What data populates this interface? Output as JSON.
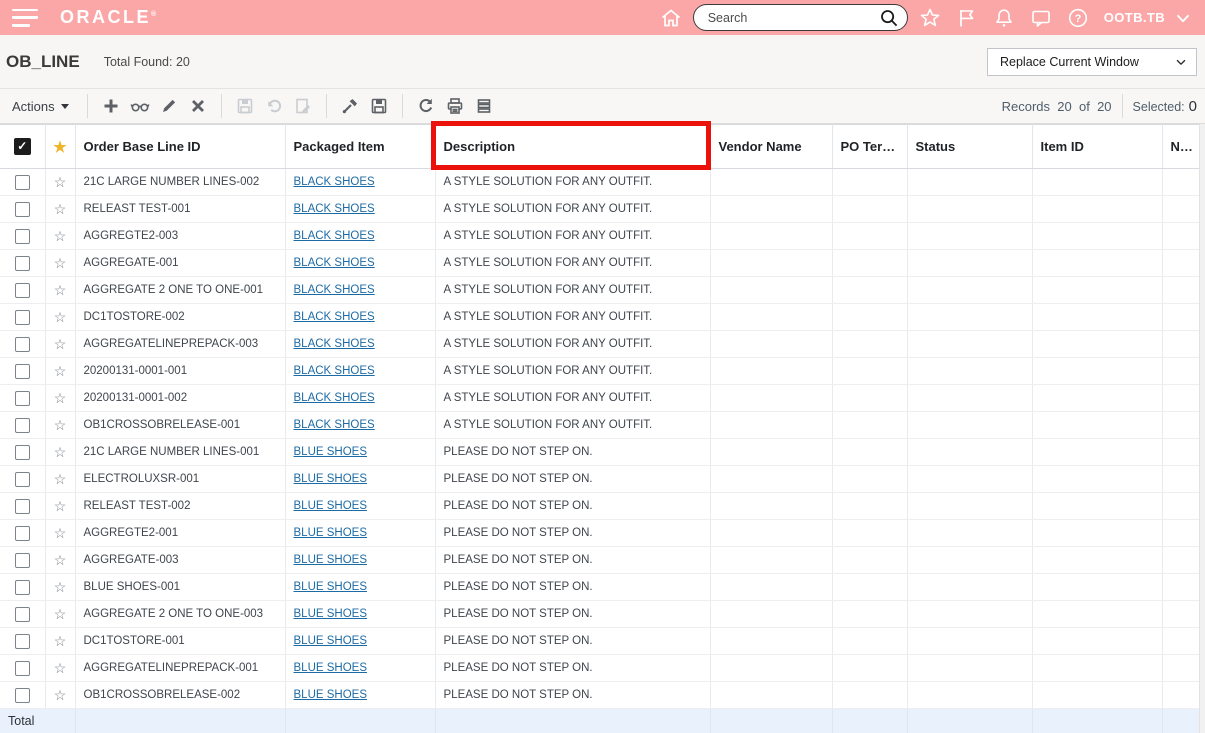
{
  "colors": {
    "header_bg": "#fba7a7",
    "link": "#1d6ba5",
    "annotation_red": "#ea120b",
    "total_row_bg": "#e9f2fc",
    "star_gold": "#f0b429"
  },
  "header": {
    "brand": "ORACLE",
    "search_placeholder": "Search",
    "username": "OOTB.TB",
    "icons": [
      "menu-icon",
      "home-icon",
      "search-icon",
      "favorites-icon",
      "flag-icon",
      "notifications-icon",
      "messages-icon",
      "help-icon",
      "chevron-down-icon"
    ]
  },
  "title_bar": {
    "title": "OB_LINE",
    "total_found": "Total Found: 20",
    "window_mode": "Replace Current Window"
  },
  "toolbar": {
    "actions_label": "Actions",
    "icons": [
      "add-icon",
      "view-icon",
      "edit-icon",
      "delete-icon",
      "save-icon",
      "undo-icon",
      "edit-note-icon",
      "tools-icon",
      "save-layout-icon",
      "refresh-icon",
      "print-icon",
      "detach-icon"
    ],
    "records_label": "Records",
    "records_count": "20",
    "records_of": "of",
    "records_total": "20",
    "selected_label": "Selected:",
    "selected_count": "0"
  },
  "table": {
    "columns": [
      "Order Base Line ID",
      "Packaged Item",
      "Description",
      "Vendor Name",
      "PO Terms",
      "Status",
      "Item ID",
      "NLT"
    ],
    "total_label": "Total",
    "rows": [
      {
        "order_base_line_id": "21C LARGE NUMBER LINES-002",
        "packaged_item": "BLACK SHOES",
        "description": "A STYLE SOLUTION FOR ANY OUTFIT.",
        "vendor_name": "",
        "po_terms": "",
        "status": "",
        "item_id": "",
        "nlt": ""
      },
      {
        "order_base_line_id": "RELEAST TEST-001",
        "packaged_item": "BLACK SHOES",
        "description": "A STYLE SOLUTION FOR ANY OUTFIT.",
        "vendor_name": "",
        "po_terms": "",
        "status": "",
        "item_id": "",
        "nlt": ""
      },
      {
        "order_base_line_id": "AGGREGTE2-003",
        "packaged_item": "BLACK SHOES",
        "description": "A STYLE SOLUTION FOR ANY OUTFIT.",
        "vendor_name": "",
        "po_terms": "",
        "status": "",
        "item_id": "",
        "nlt": ""
      },
      {
        "order_base_line_id": "AGGREGATE-001",
        "packaged_item": "BLACK SHOES",
        "description": "A STYLE SOLUTION FOR ANY OUTFIT.",
        "vendor_name": "",
        "po_terms": "",
        "status": "",
        "item_id": "",
        "nlt": ""
      },
      {
        "order_base_line_id": "AGGREGATE 2 ONE TO ONE-001",
        "packaged_item": "BLACK SHOES",
        "description": "A STYLE SOLUTION FOR ANY OUTFIT.",
        "vendor_name": "",
        "po_terms": "",
        "status": "",
        "item_id": "",
        "nlt": ""
      },
      {
        "order_base_line_id": "DC1TOSTORE-002",
        "packaged_item": "BLACK SHOES",
        "description": "A STYLE SOLUTION FOR ANY OUTFIT.",
        "vendor_name": "",
        "po_terms": "",
        "status": "",
        "item_id": "",
        "nlt": ""
      },
      {
        "order_base_line_id": "AGGREGATELINEPREPACK-003",
        "packaged_item": "BLACK SHOES",
        "description": "A STYLE SOLUTION FOR ANY OUTFIT.",
        "vendor_name": "",
        "po_terms": "",
        "status": "",
        "item_id": "",
        "nlt": ""
      },
      {
        "order_base_line_id": "20200131-0001-001",
        "packaged_item": "BLACK SHOES",
        "description": "A STYLE SOLUTION FOR ANY OUTFIT.",
        "vendor_name": "",
        "po_terms": "",
        "status": "",
        "item_id": "",
        "nlt": ""
      },
      {
        "order_base_line_id": "20200131-0001-002",
        "packaged_item": "BLACK SHOES",
        "description": "A STYLE SOLUTION FOR ANY OUTFIT.",
        "vendor_name": "",
        "po_terms": "",
        "status": "",
        "item_id": "",
        "nlt": ""
      },
      {
        "order_base_line_id": "OB1CROSSOBRELEASE-001",
        "packaged_item": "BLACK SHOES",
        "description": "A STYLE SOLUTION FOR ANY OUTFIT.",
        "vendor_name": "",
        "po_terms": "",
        "status": "",
        "item_id": "",
        "nlt": ""
      },
      {
        "order_base_line_id": "21C LARGE NUMBER LINES-001",
        "packaged_item": "BLUE SHOES",
        "description": "PLEASE DO NOT STEP ON.",
        "vendor_name": "",
        "po_terms": "",
        "status": "",
        "item_id": "",
        "nlt": ""
      },
      {
        "order_base_line_id": "ELECTROLUXSR-001",
        "packaged_item": "BLUE SHOES",
        "description": "PLEASE DO NOT STEP ON.",
        "vendor_name": "",
        "po_terms": "",
        "status": "",
        "item_id": "",
        "nlt": ""
      },
      {
        "order_base_line_id": "RELEAST TEST-002",
        "packaged_item": "BLUE SHOES",
        "description": "PLEASE DO NOT STEP ON.",
        "vendor_name": "",
        "po_terms": "",
        "status": "",
        "item_id": "",
        "nlt": ""
      },
      {
        "order_base_line_id": "AGGREGTE2-001",
        "packaged_item": "BLUE SHOES",
        "description": "PLEASE DO NOT STEP ON.",
        "vendor_name": "",
        "po_terms": "",
        "status": "",
        "item_id": "",
        "nlt": ""
      },
      {
        "order_base_line_id": "AGGREGATE-003",
        "packaged_item": "BLUE SHOES",
        "description": "PLEASE DO NOT STEP ON.",
        "vendor_name": "",
        "po_terms": "",
        "status": "",
        "item_id": "",
        "nlt": ""
      },
      {
        "order_base_line_id": "BLUE SHOES-001",
        "packaged_item": "BLUE SHOES",
        "description": "PLEASE DO NOT STEP ON.",
        "vendor_name": "",
        "po_terms": "",
        "status": "",
        "item_id": "",
        "nlt": ""
      },
      {
        "order_base_line_id": "AGGREGATE 2 ONE TO ONE-003",
        "packaged_item": "BLUE SHOES",
        "description": "PLEASE DO NOT STEP ON.",
        "vendor_name": "",
        "po_terms": "",
        "status": "",
        "item_id": "",
        "nlt": ""
      },
      {
        "order_base_line_id": "DC1TOSTORE-001",
        "packaged_item": "BLUE SHOES",
        "description": "PLEASE DO NOT STEP ON.",
        "vendor_name": "",
        "po_terms": "",
        "status": "",
        "item_id": "",
        "nlt": ""
      },
      {
        "order_base_line_id": "AGGREGATELINEPREPACK-001",
        "packaged_item": "BLUE SHOES",
        "description": "PLEASE DO NOT STEP ON.",
        "vendor_name": "",
        "po_terms": "",
        "status": "",
        "item_id": "",
        "nlt": ""
      },
      {
        "order_base_line_id": "OB1CROSSOBRELEASE-002",
        "packaged_item": "BLUE SHOES",
        "description": "PLEASE DO NOT STEP ON.",
        "vendor_name": "",
        "po_terms": "",
        "status": "",
        "item_id": "",
        "nlt": ""
      }
    ]
  }
}
